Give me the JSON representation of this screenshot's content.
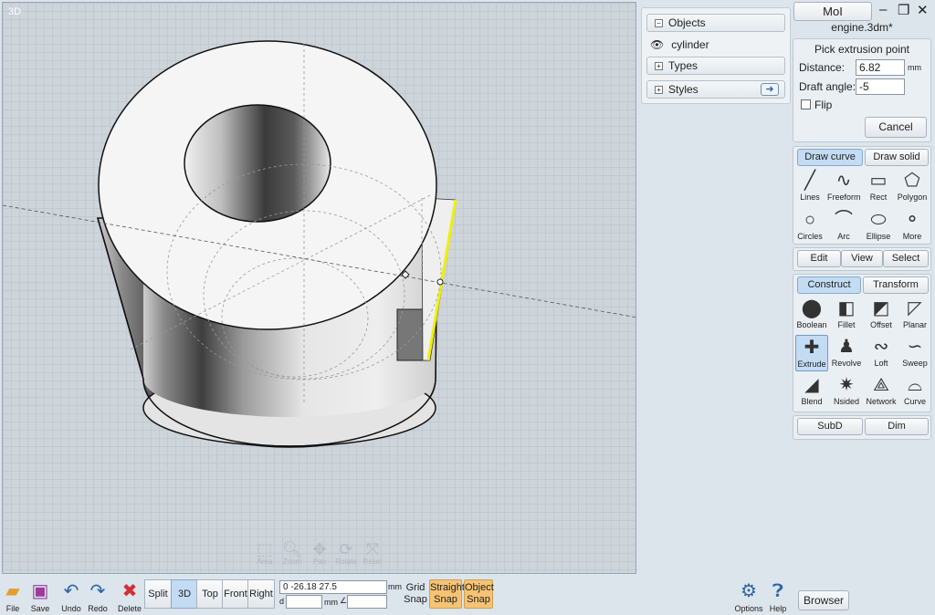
{
  "viewport": {
    "label": "3D"
  },
  "nav_controls": [
    {
      "name": "Area",
      "icon": "area-zoom-icon"
    },
    {
      "name": "Zoom",
      "icon": "zoom-icon"
    },
    {
      "name": "Pan",
      "icon": "pan-icon"
    },
    {
      "name": "Rotate",
      "icon": "rotate-icon"
    },
    {
      "name": "Reset",
      "icon": "reset-icon"
    }
  ],
  "browser": {
    "objects": "Objects",
    "object_item": "cylinder",
    "types": "Types",
    "styles": "Styles"
  },
  "app": {
    "name": "MoI",
    "file": "engine.3dm*"
  },
  "command": {
    "title": "Pick extrusion point",
    "distance_label": "Distance:",
    "distance_value": "6.82",
    "distance_unit": "mm",
    "draft_label": "Draft angle:",
    "draft_value": "-5",
    "flip_label": "Flip",
    "cancel": "Cancel"
  },
  "draw": {
    "tab_curve": "Draw curve",
    "tab_solid": "Draw solid",
    "tools": [
      "Lines",
      "Freeform",
      "Rect",
      "Polygon",
      "Circles",
      "Arc",
      "Ellipse",
      "More"
    ]
  },
  "mode": {
    "edit": "Edit",
    "view": "View",
    "select": "Select"
  },
  "construct": {
    "tab_construct": "Construct",
    "tab_transform": "Transform",
    "tools": [
      "Boolean",
      "Fillet",
      "Offset",
      "Planar",
      "Extrude",
      "Revolve",
      "Loft",
      "Sweep",
      "Blend",
      "Nsided",
      "Network",
      "Curve"
    ],
    "active": "Extrude"
  },
  "bottom_group": {
    "subd": "SubD",
    "dim": "Dim"
  },
  "bottom": {
    "file": "File",
    "save": "Save",
    "undo": "Undo",
    "redo": "Redo",
    "delete": "Delete",
    "views": [
      "Split",
      "3D",
      "Top",
      "Front",
      "Right"
    ],
    "active_view": "3D",
    "coords": "0      -26.18   27.5",
    "coord_unit": "mm",
    "d_label": "d",
    "d_unit": "mm",
    "grid_snap": [
      "Grid",
      "Snap"
    ],
    "straight_snap": [
      "Straight",
      "Snap"
    ],
    "object_snap": [
      "Object",
      "Snap"
    ],
    "options": "Options",
    "help": "Help",
    "browser": "Browser"
  },
  "colors": {
    "accent": "#c3dcf3",
    "snap": "#f6c374",
    "highlight": "#f0f000"
  }
}
